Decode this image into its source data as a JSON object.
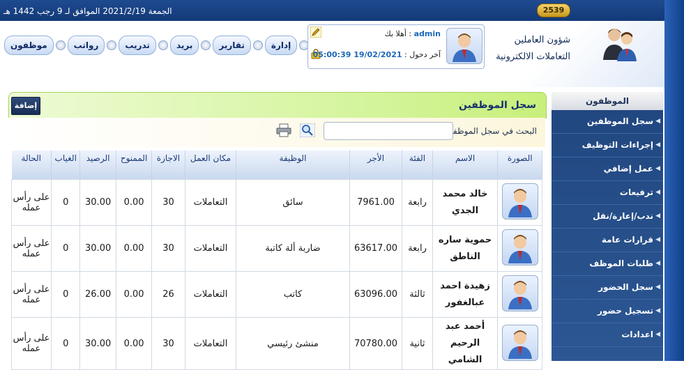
{
  "topbar": {
    "date_text": "الجمعة 2021/2/19 الموافق لـ 9 رجب 1442 هـ",
    "counter": "2539"
  },
  "nav": {
    "items": [
      {
        "label": "موظفون"
      },
      {
        "label": "رواتب"
      },
      {
        "label": "تدريب"
      },
      {
        "label": "بريد"
      },
      {
        "label": "تقارير"
      },
      {
        "label": "إدارة"
      }
    ]
  },
  "user": {
    "welcome_label": "أهلا بك :",
    "username": "admin",
    "last_login_label": "آخر دخول :",
    "last_login_value": "19/02/2021 05:00:39"
  },
  "system": {
    "line1": "شؤون العاملين",
    "line2": "التعاملات الالكترونية"
  },
  "sidebar": {
    "header": "الموظفون",
    "items": [
      {
        "label": "سجل الموظفين"
      },
      {
        "label": "إجراءات التوظيف"
      },
      {
        "label": "عمل إضافي"
      },
      {
        "label": "ترفيعات"
      },
      {
        "label": "ندب/إعارة/نقل"
      },
      {
        "label": "قرارات عامة"
      },
      {
        "label": "طلبات الموظف"
      },
      {
        "label": "سجل الحضور"
      },
      {
        "label": "تسجيل حضور"
      },
      {
        "label": "اعدادات"
      }
    ]
  },
  "content": {
    "title": "سجل الموظفين",
    "add_label": "إضافة",
    "search_label": "البحث في سجل الموظفين",
    "search_value": "",
    "columns": {
      "photo": "الصورة",
      "name": "الاسم",
      "grade": "الفئة",
      "salary": "الأجر",
      "job": "الوظيفة",
      "workplace": "مكان العمل",
      "leave": "الاجازة",
      "granted": "الممنوح",
      "balance": "الرصيد",
      "absence": "الغياب",
      "status": "الحالة"
    },
    "rows": [
      {
        "name_line1": "خالد محمد",
        "name_line2": "الجدي",
        "grade": "رابعة",
        "salary": "7961.00",
        "job": "سائق",
        "workplace": "التعاملات",
        "leave": "30",
        "granted": "0.00",
        "balance": "30.00",
        "absence": "0",
        "status_line1": "على رأس",
        "status_line2": "عمله"
      },
      {
        "name_line1": "حموية ساره",
        "name_line2": "الناطق",
        "grade": "رابعة",
        "salary": "63617.00",
        "job": "ضاربة ألة كاتبة",
        "workplace": "التعاملات",
        "leave": "30",
        "granted": "0.00",
        "balance": "30.00",
        "absence": "0",
        "status_line1": "على رأس",
        "status_line2": "عمله"
      },
      {
        "name_line1": "زهيدة احمد",
        "name_line2": "عبالغفور",
        "grade": "ثالثة",
        "salary": "63096.00",
        "job": "كاتب",
        "workplace": "التعاملات",
        "leave": "26",
        "granted": "0.00",
        "balance": "26.00",
        "absence": "0",
        "status_line1": "على رأس",
        "status_line2": "عمله"
      },
      {
        "name_line1": "أحمد عبد الرحيم",
        "name_line2": "الشامي",
        "grade": "ثانية",
        "salary": "70780.00",
        "job": "منشئ رئيسي",
        "workplace": "التعاملات",
        "leave": "30",
        "granted": "0.00",
        "balance": "30.00",
        "absence": "0",
        "status_line1": "على رأس",
        "status_line2": "عمله"
      }
    ]
  },
  "colors": {
    "topbar": "#123a78",
    "sidebar": "#21467f",
    "title_bar": "#d7f5a2",
    "accent_text": "#1a68b8"
  }
}
